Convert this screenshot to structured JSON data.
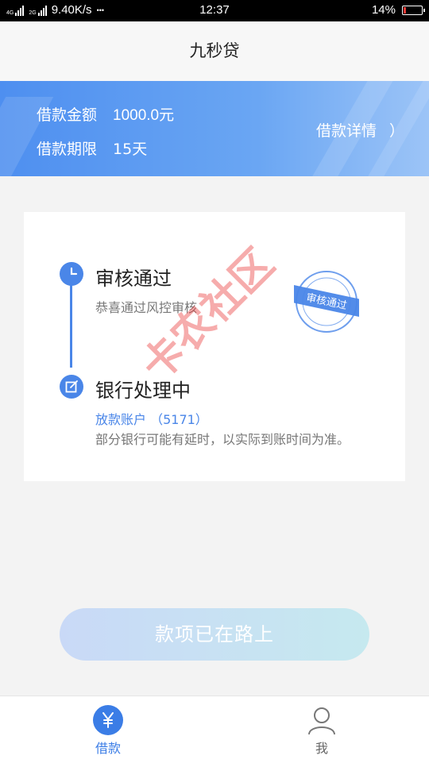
{
  "status_bar": {
    "net1": "4G",
    "net2": "2G",
    "speed": "9.40K/s",
    "dots": "•••",
    "time": "12:37",
    "battery": "14%",
    "battery_level": 0.14,
    "battery_color": "#e53935"
  },
  "title": "九秒贷",
  "banner": {
    "amount_label": "借款金额",
    "amount_value": "1000.0元",
    "term_label": "借款期限",
    "term_value": "15天",
    "detail_label": "借款详情",
    "detail_arrow": "）"
  },
  "steps": [
    {
      "title": "审核通过",
      "subtitle": "恭喜通过风控审核",
      "icon": "clock-icon"
    },
    {
      "title": "银行处理中",
      "account": "放款账户 （5171）",
      "note": "部分银行可能有延时，以实际到账时间为准。",
      "icon": "edit-icon"
    }
  ],
  "stamp": "审核通过",
  "watermark": "卡农社区",
  "cta_label": "款项已在路上",
  "tabs": [
    {
      "label": "借款",
      "icon": "yen-icon",
      "active": true
    },
    {
      "label": "我",
      "icon": "user-icon",
      "active": false
    }
  ],
  "colors": {
    "accent": "#4a86e8",
    "tab_active": "#3b7de6"
  }
}
